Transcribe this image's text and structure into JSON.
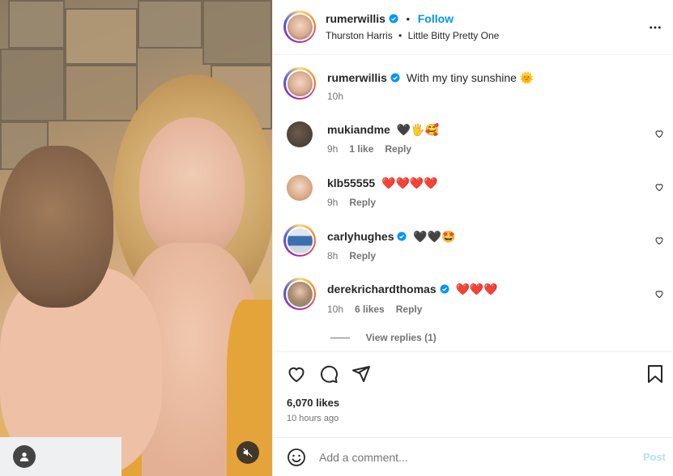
{
  "header": {
    "username": "rumerwillis",
    "separator": "•",
    "follow_label": "Follow",
    "audio_artist": "Thurston Harris",
    "audio_separator": "•",
    "audio_title": "Little Bitty Pretty One",
    "more_icon": "more-dots-icon"
  },
  "caption": {
    "username": "rumerwillis",
    "text": "With my tiny sunshine 🌞",
    "time": "10h"
  },
  "comments": [
    {
      "username": "mukiandme",
      "text": "🖤🖐🥰",
      "time": "9h",
      "likes": "1 like",
      "reply": "Reply"
    },
    {
      "username": "klb55555",
      "text": "❤️❤️❤️❤️",
      "time": "9h",
      "likes": "",
      "reply": "Reply"
    },
    {
      "username": "carlyhughes",
      "text": "🖤🖤🤩",
      "time": "8h",
      "likes": "",
      "reply": "Reply"
    },
    {
      "username": "derekrichardthomas",
      "text": "❤️❤️❤️",
      "time": "10h",
      "likes": "6 likes",
      "reply": "Reply"
    }
  ],
  "view_replies": "View replies (1)",
  "stats": {
    "likes": "6,070 likes",
    "posted": "10 hours ago"
  },
  "comment_box": {
    "placeholder": "Add a comment...",
    "post_label": "Post"
  },
  "colors": {
    "accent": "#0095f6",
    "verified": "#0095f6",
    "text": "#262626",
    "muted": "#737373"
  }
}
